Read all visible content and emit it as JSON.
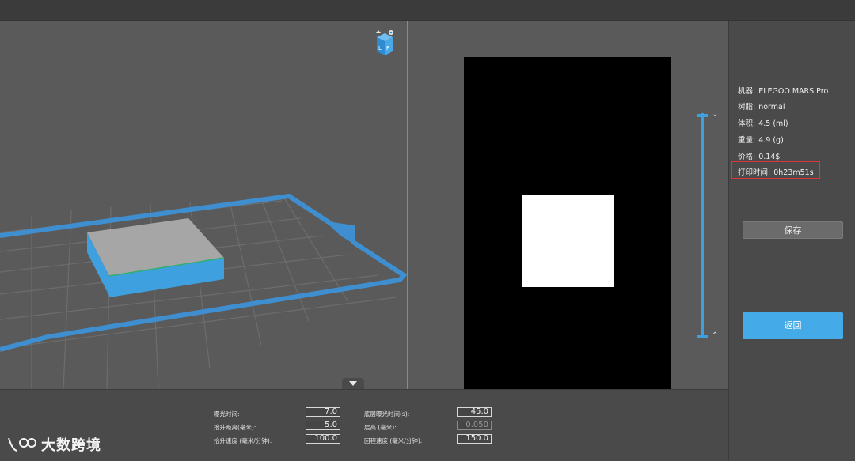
{
  "viewport3d": {
    "view_cube_icon": "view-cube-icon",
    "colors": {
      "grid_bg": "#5a5a5a",
      "plate_border": "#3f8fd0",
      "model_top": "#a5a5a5",
      "model_side": "#3fa0e0"
    }
  },
  "slice_preview": {
    "colors": {
      "canvas": "#000000",
      "cross_section": "#ffffff",
      "layer_slider": "#3fa0e0"
    },
    "chevron_up": "⌃",
    "chevron_down": "⌄"
  },
  "info": {
    "machine": {
      "label": "机器:",
      "value": "ELEGOO MARS Pro"
    },
    "resin": {
      "label": "树脂:",
      "value": "normal"
    },
    "volume": {
      "label": "体积:",
      "value": "4.5 (ml)"
    },
    "weight": {
      "label": "重量:",
      "value": "4.9 (g)"
    },
    "price": {
      "label": "价格:",
      "value": "0.14$"
    },
    "print_time": {
      "label": "打印时间:",
      "value": "0h23m51s"
    }
  },
  "buttons": {
    "save": "保存",
    "back": "返回",
    "accent": "#45abe8"
  },
  "params": {
    "exposure_time": {
      "label": "曝光时间:",
      "value": "7.0"
    },
    "lift_distance": {
      "label": "抬升距离(毫米):",
      "value": "5.0"
    },
    "lift_speed": {
      "label": "抬升速度 (毫米/分钟):",
      "value": "100.0"
    },
    "bottom_exposure": {
      "label": "底层曝光时间(s):",
      "value": "45.0"
    },
    "layer_height": {
      "label": "层高 (毫米):",
      "value": "0.050"
    },
    "retract_speed": {
      "label": "回程速度 (毫米/分钟):",
      "value": "150.0"
    }
  },
  "watermark": {
    "text": "大数跨境"
  }
}
